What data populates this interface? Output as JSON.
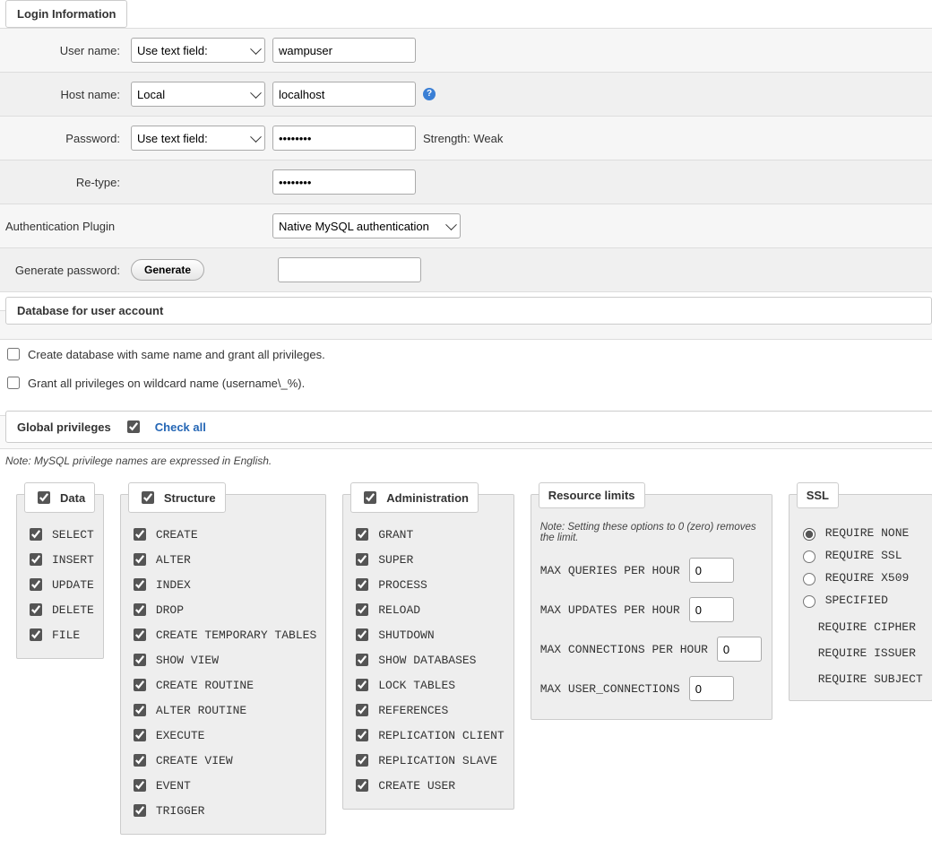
{
  "login": {
    "legend": "Login Information",
    "username_label": "User name:",
    "username_select": "Use text field:",
    "username_value": "wampuser",
    "hostname_label": "Host name:",
    "hostname_select": "Local",
    "hostname_value": "localhost",
    "password_label": "Password:",
    "password_select": "Use text field:",
    "password_value": "••••••••",
    "strength_label": "Strength:",
    "strength_value": "Weak",
    "retype_label": "Re-type:",
    "retype_value": "••••••••",
    "auth_label": "Authentication Plugin",
    "auth_value": "Native MySQL authentication",
    "genpwd_label": "Generate password:",
    "generate_btn": "Generate"
  },
  "db": {
    "legend": "Database for user account",
    "opt1": "Create database with same name and grant all privileges.",
    "opt2": "Grant all privileges on wildcard name (username\\_%)."
  },
  "gp": {
    "legend": "Global privileges",
    "check_all": "Check all",
    "note": "Note: MySQL privilege names are expressed in English."
  },
  "data_box": {
    "title": "Data",
    "items": [
      "SELECT",
      "INSERT",
      "UPDATE",
      "DELETE",
      "FILE"
    ]
  },
  "structure_box": {
    "title": "Structure",
    "items": [
      "CREATE",
      "ALTER",
      "INDEX",
      "DROP",
      "CREATE TEMPORARY TABLES",
      "SHOW VIEW",
      "CREATE ROUTINE",
      "ALTER ROUTINE",
      "EXECUTE",
      "CREATE VIEW",
      "EVENT",
      "TRIGGER"
    ]
  },
  "admin_box": {
    "title": "Administration",
    "items": [
      "GRANT",
      "SUPER",
      "PROCESS",
      "RELOAD",
      "SHUTDOWN",
      "SHOW DATABASES",
      "LOCK TABLES",
      "REFERENCES",
      "REPLICATION CLIENT",
      "REPLICATION SLAVE",
      "CREATE USER"
    ]
  },
  "res_box": {
    "title": "Resource limits",
    "note": "Note: Setting these options to 0 (zero) removes the limit.",
    "items": [
      {
        "label": "MAX QUERIES PER HOUR",
        "value": "0"
      },
      {
        "label": "MAX UPDATES PER HOUR",
        "value": "0"
      },
      {
        "label": "MAX CONNECTIONS PER HOUR",
        "value": "0"
      },
      {
        "label": "MAX USER_CONNECTIONS",
        "value": "0"
      }
    ]
  },
  "ssl_box": {
    "title": "SSL",
    "options": [
      "REQUIRE NONE",
      "REQUIRE SSL",
      "REQUIRE X509",
      "SPECIFIED"
    ],
    "selected": 0,
    "sub": [
      "REQUIRE CIPHER",
      "REQUIRE ISSUER",
      "REQUIRE SUBJECT"
    ]
  }
}
